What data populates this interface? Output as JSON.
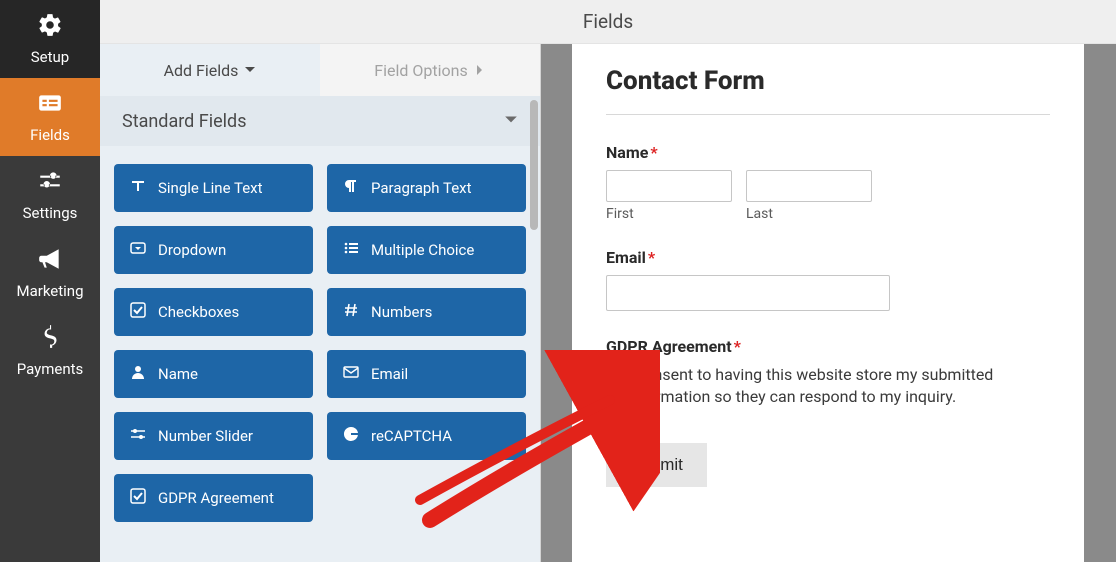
{
  "topbar": {
    "title": "Fields"
  },
  "sidebar": {
    "items": [
      {
        "label": "Setup",
        "icon": "gear-icon"
      },
      {
        "label": "Fields",
        "icon": "form-icon"
      },
      {
        "label": "Settings",
        "icon": "sliders-icon"
      },
      {
        "label": "Marketing",
        "icon": "bullhorn-icon"
      },
      {
        "label": "Payments",
        "icon": "dollar-icon"
      }
    ]
  },
  "panel": {
    "tabs": {
      "add_fields": "Add Fields",
      "field_options": "Field Options"
    },
    "group_header": "Standard Fields",
    "fields": [
      "Single Line Text",
      "Paragraph Text",
      "Dropdown",
      "Multiple Choice",
      "Checkboxes",
      "Numbers",
      "Name",
      "Email",
      "Number Slider",
      "reCAPTCHA",
      "GDPR Agreement"
    ]
  },
  "preview": {
    "title": "Contact Form",
    "name_label": "Name",
    "first_sub": "First",
    "last_sub": "Last",
    "email_label": "Email",
    "gdpr_label": "GDPR Agreement",
    "consent_text": "I consent to having this website store my submitted information so they can respond to my inquiry.",
    "submit_label": "Submit",
    "required_mark": "*"
  }
}
